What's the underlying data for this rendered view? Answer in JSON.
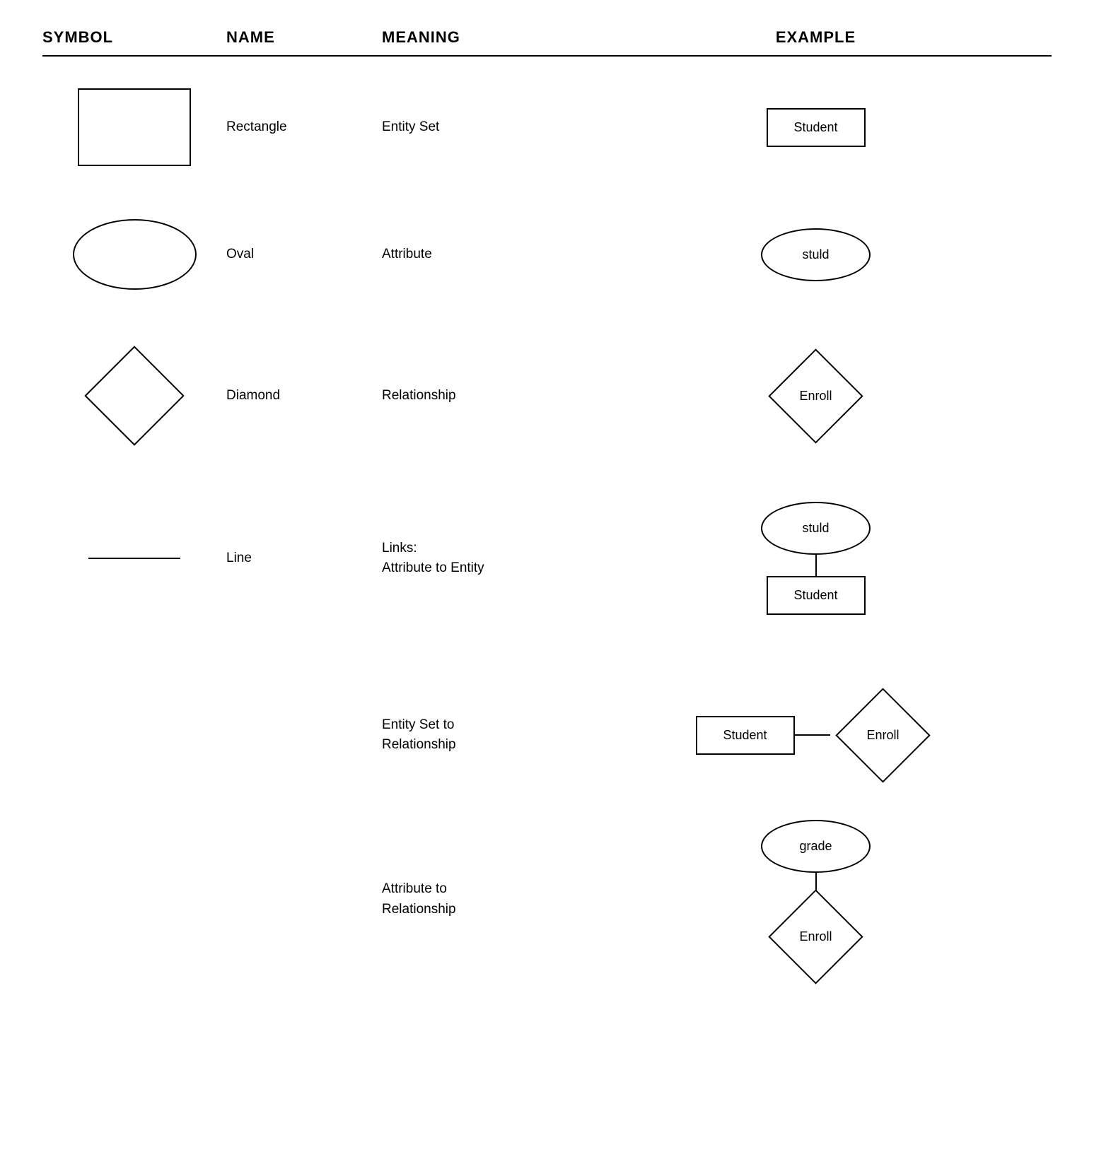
{
  "header": {
    "col1": "SYMBOL",
    "col2": "NAME",
    "col3": "MEANING",
    "col4": "EXAMPLE"
  },
  "rows": [
    {
      "id": "rectangle",
      "name": "Rectangle",
      "meaning": "Entity Set",
      "example_label": "Student"
    },
    {
      "id": "oval",
      "name": "Oval",
      "meaning": "Attribute",
      "example_label": "stuld"
    },
    {
      "id": "diamond",
      "name": "Diamond",
      "meaning": "Relationship",
      "example_label": "Enroll"
    },
    {
      "id": "line",
      "name": "Line",
      "meaning_line1": "Links:",
      "meaning_line2": "Attribute to Entity",
      "example_oval": "stuld",
      "example_rect": "Student"
    }
  ],
  "extra_rows": [
    {
      "id": "entity-set-to-relationship",
      "meaning_line1": "Entity Set to",
      "meaning_line2": "Relationship",
      "example_rect": "Student",
      "example_diamond": "Enroll"
    },
    {
      "id": "attribute-to-relationship",
      "meaning_line1": "Attribute to",
      "meaning_line2": "Relationship",
      "example_oval": "grade",
      "example_diamond": "Enroll"
    }
  ]
}
